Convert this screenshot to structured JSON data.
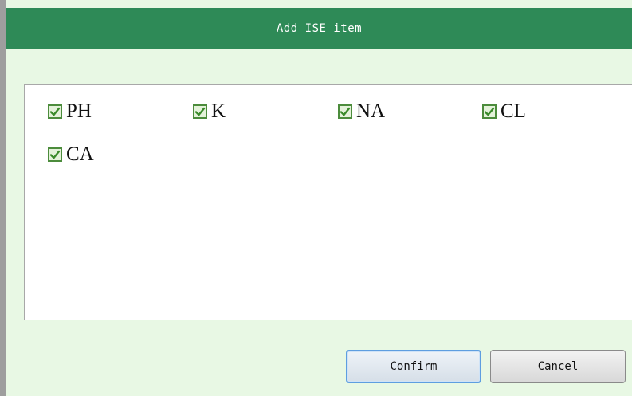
{
  "dialog": {
    "title": "Add ISE item"
  },
  "items": [
    {
      "label": "PH",
      "checked": true
    },
    {
      "label": "K",
      "checked": true
    },
    {
      "label": "NA",
      "checked": true
    },
    {
      "label": "CL",
      "checked": true
    },
    {
      "label": "CA",
      "checked": true
    }
  ],
  "buttons": {
    "confirm_label": "Confirm",
    "cancel_label": "Cancel"
  },
  "colors": {
    "titlebar": "#2e8a57",
    "background": "#e8f8e4",
    "check": "#3a8a2a"
  }
}
